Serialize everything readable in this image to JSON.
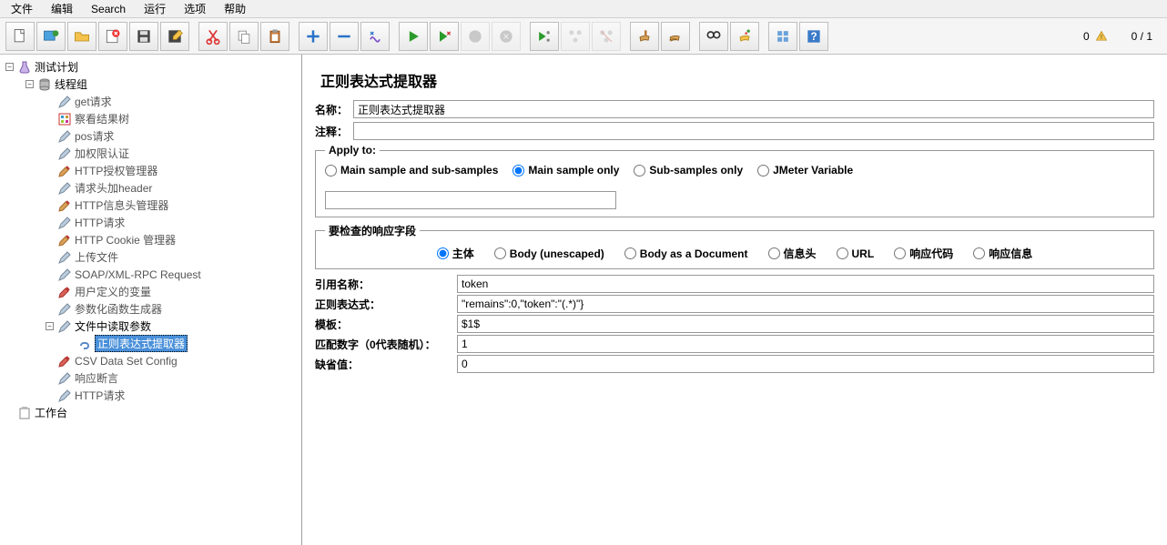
{
  "menu": {
    "file": "文件",
    "edit": "编辑",
    "search": "Search",
    "run": "运行",
    "options": "选项",
    "help": "帮助"
  },
  "status": {
    "left_count": "0",
    "right_ratio": "0 / 1"
  },
  "tree": {
    "root": "测试计划",
    "thread_group": "线程组",
    "items_a": [
      "get请求",
      "察看结果树",
      "pos请求",
      "加权限认证",
      "HTTP授权管理器",
      "请求头加header",
      "HTTP信息头管理器",
      "HTTP请求",
      "HTTP Cookie 管理器",
      "上传文件",
      "SOAP/XML-RPC Request",
      "用户定义的变量",
      "参数化函数生成器"
    ],
    "node_file_param": "文件中读取参数",
    "selected": "正则表达式提取器",
    "items_b": [
      "CSV Data Set Config",
      "响应断言",
      "HTTP请求"
    ],
    "workbench": "工作台"
  },
  "panel": {
    "title": "正则表达式提取器",
    "name_label": "名称：",
    "name_value": "正则表达式提取器",
    "comment_label": "注释：",
    "comment_value": "",
    "apply_legend": "Apply to:",
    "apply_options": [
      "Main sample and sub-samples",
      "Main sample only",
      "Sub-samples only",
      "JMeter Variable"
    ],
    "check_legend": "要检查的响应字段",
    "check_options": [
      "主体",
      "Body (unescaped)",
      "Body as a Document",
      "信息头",
      "URL",
      "响应代码",
      "响应信息"
    ],
    "ref_name_label": "引用名称：",
    "ref_name_value": "token",
    "regex_label": "正则表达式：",
    "regex_value": "\"remains\":0,\"token\":\"(.*)\"}",
    "template_label": "模板：",
    "template_value": "$1$",
    "match_label": "匹配数字（0代表随机）：",
    "match_value": "1",
    "default_label": "缺省值：",
    "default_value": "0"
  }
}
